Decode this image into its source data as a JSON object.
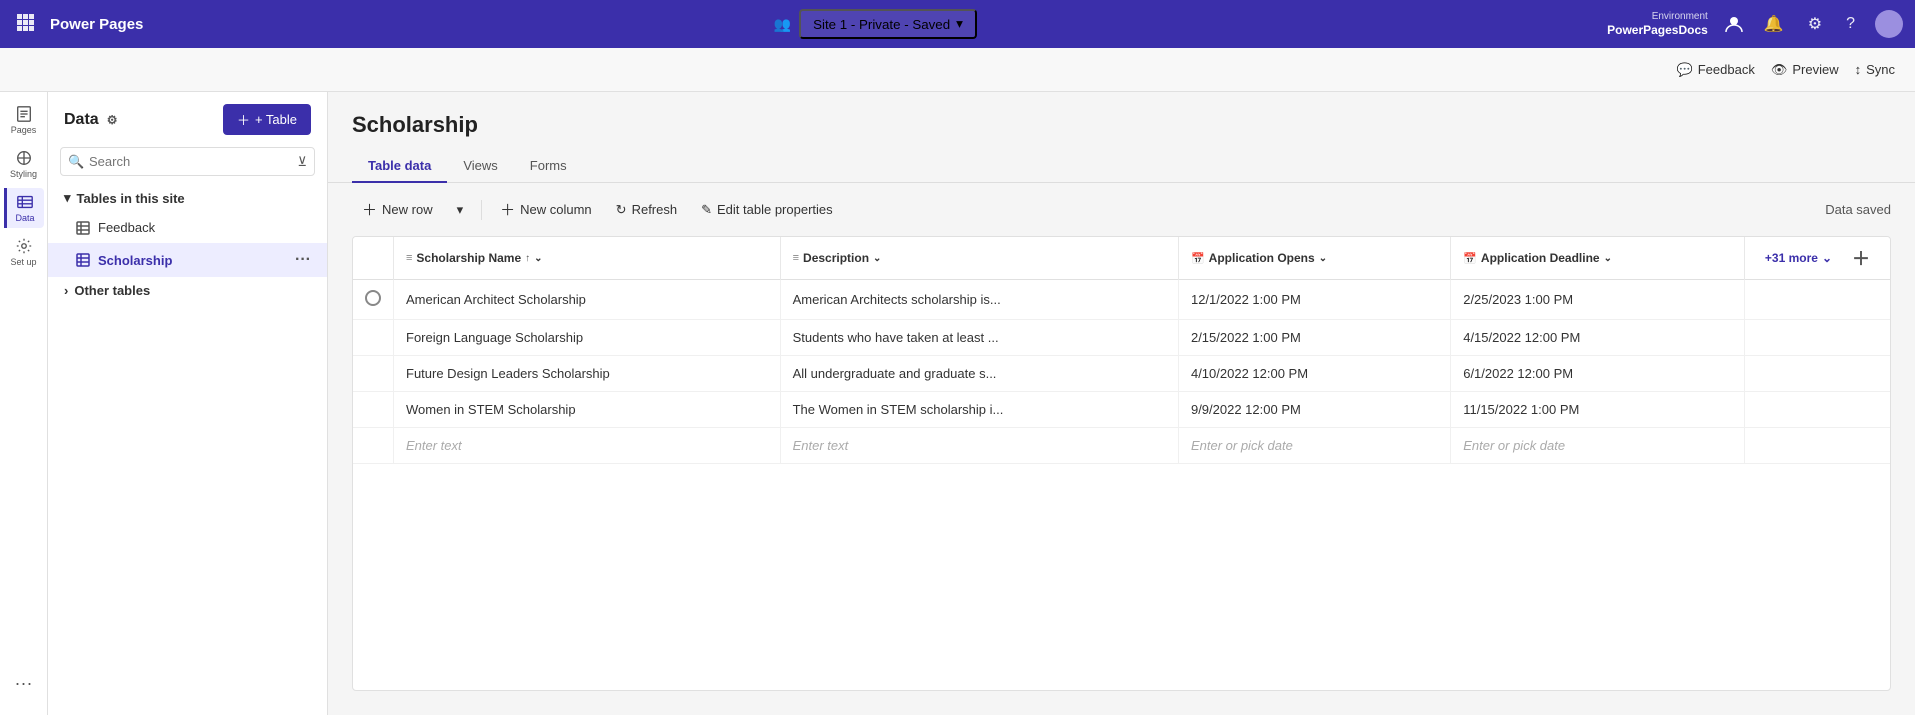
{
  "topNav": {
    "appName": "Power Pages",
    "environment": {
      "label": "Environment",
      "name": "PowerPagesDocs"
    },
    "siteSelector": {
      "text": "Site 1 - Private - Saved"
    },
    "actions": {
      "feedback": "Feedback",
      "preview": "Preview",
      "sync": "Sync"
    }
  },
  "iconRail": {
    "items": [
      {
        "label": "Pages",
        "icon": "pages"
      },
      {
        "label": "Styling",
        "icon": "styling"
      },
      {
        "label": "Data",
        "icon": "data",
        "active": true
      },
      {
        "label": "Set up",
        "icon": "setup"
      }
    ]
  },
  "sidebar": {
    "title": "Data",
    "addTableBtn": "+ Table",
    "search": {
      "placeholder": "Search"
    },
    "sections": [
      {
        "label": "Tables in this site",
        "expanded": true,
        "items": [
          {
            "label": "Feedback",
            "active": false
          },
          {
            "label": "Scholarship",
            "active": true
          }
        ]
      },
      {
        "label": "Other tables",
        "expanded": false,
        "items": []
      }
    ]
  },
  "mainContent": {
    "pageTitle": "Scholarship",
    "tabs": [
      {
        "label": "Table data",
        "active": true
      },
      {
        "label": "Views",
        "active": false
      },
      {
        "label": "Forms",
        "active": false
      }
    ],
    "toolbar": {
      "newRow": "New row",
      "newColumn": "New column",
      "refresh": "Refresh",
      "editTableProperties": "Edit table properties",
      "dataSaved": "Data saved"
    },
    "table": {
      "columns": [
        {
          "label": "Scholarship Name",
          "type": "text",
          "sortable": true
        },
        {
          "label": "Description",
          "type": "text",
          "sortable": true
        },
        {
          "label": "Application Opens",
          "type": "date",
          "sortable": true
        },
        {
          "label": "Application Deadline",
          "type": "date",
          "sortable": true
        }
      ],
      "plusMoreLabel": "+31 more",
      "rows": [
        {
          "scholarshipName": "American Architect Scholarship",
          "description": "American Architects scholarship is...",
          "applicationOpens": "12/1/2022 1:00 PM",
          "applicationDeadline": "2/25/2023 1:00 PM"
        },
        {
          "scholarshipName": "Foreign Language Scholarship",
          "description": "Students who have taken at least ...",
          "applicationOpens": "2/15/2022 1:00 PM",
          "applicationDeadline": "4/15/2022 12:00 PM"
        },
        {
          "scholarshipName": "Future Design Leaders Scholarship",
          "description": "All undergraduate and graduate s...",
          "applicationOpens": "4/10/2022 12:00 PM",
          "applicationDeadline": "6/1/2022 12:00 PM"
        },
        {
          "scholarshipName": "Women in STEM Scholarship",
          "description": "The Women in STEM scholarship i...",
          "applicationOpens": "9/9/2022 12:00 PM",
          "applicationDeadline": "11/15/2022 1:00 PM"
        }
      ],
      "emptyRow": {
        "textPlaceholder": "Enter text",
        "datePlaceholder": "Enter or pick date"
      }
    }
  }
}
